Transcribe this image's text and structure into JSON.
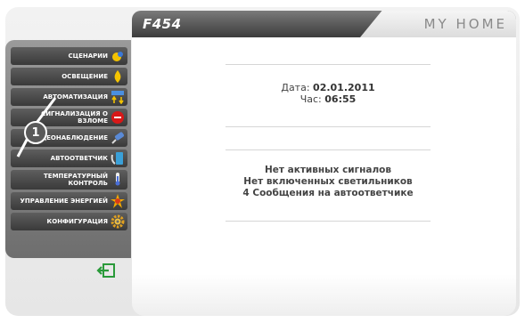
{
  "header": {
    "model": "F454",
    "brand": "MY HOME"
  },
  "sidebar": {
    "items": [
      {
        "label": "СЦЕНАРИИ",
        "icon": "scenario-icon"
      },
      {
        "label": "ОСВЕЩЕНИЕ",
        "icon": "lightbulb-icon"
      },
      {
        "label": "АВТОМАТИЗАЦИЯ",
        "icon": "automation-icon"
      },
      {
        "label": "СИГНАЛИЗАЦИЯ О ВЗЛОМЕ",
        "icon": "alarm-icon"
      },
      {
        "label": "ВИДЕОНАБЛЮДЕНИЕ",
        "icon": "camera-icon"
      },
      {
        "label": "АВТООТВЕТЧИК",
        "icon": "answering-machine-icon"
      },
      {
        "label": "ТЕМПЕРАТУРНЫЙ КОНТРОЛЬ",
        "icon": "thermometer-icon"
      },
      {
        "label": "УПРАВЛЕНИЕ ЭНЕРГИЕЙ",
        "icon": "energy-icon"
      },
      {
        "label": "КОНФИГУРАЦИЯ",
        "icon": "gear-icon"
      }
    ]
  },
  "main": {
    "date_label": "Дата:",
    "date_value": "02.01.2011",
    "time_label": "Час:",
    "time_value": "06:55",
    "status_lines": [
      "Нет активных сигналов",
      "Нет включенных светильников",
      "4 Сообщения на автоответчике"
    ]
  },
  "overlay": {
    "step": "1"
  }
}
